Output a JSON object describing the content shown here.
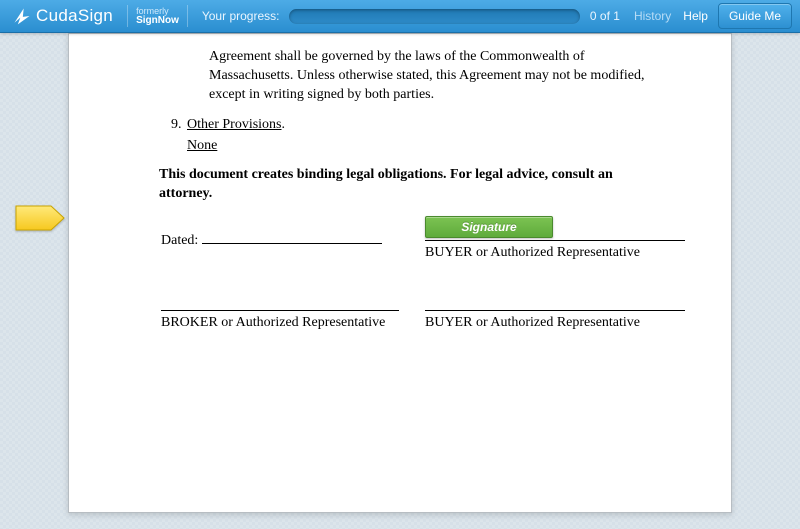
{
  "header": {
    "brand": "CudaSign",
    "formerly_label": "formerly",
    "formerly_name": "SignNow",
    "progress_label": "Your progress:",
    "progress_count": "0 of 1",
    "history": "History",
    "help": "Help",
    "guide": "Guide Me"
  },
  "document": {
    "governing_law_tail": "Agreement shall be governed by the laws of the Commonwealth of Massachusetts.  Unless otherwise stated, this Agreement may not be modified, except in writing signed by both parties.",
    "other_provisions_num": "9.",
    "other_provisions_title": "Other Provisions",
    "other_provisions_body": "None",
    "binding_notice": "This document creates binding legal obligations.  For legal advice, consult an attorney.",
    "dated_label": "Dated:",
    "buyer_label_1": "BUYER or Authorized Representative",
    "broker_label": "BROKER or Authorized Representative",
    "buyer_label_2": "BUYER or Authorized Representative"
  },
  "widgets": {
    "signature_field": "Signature"
  }
}
